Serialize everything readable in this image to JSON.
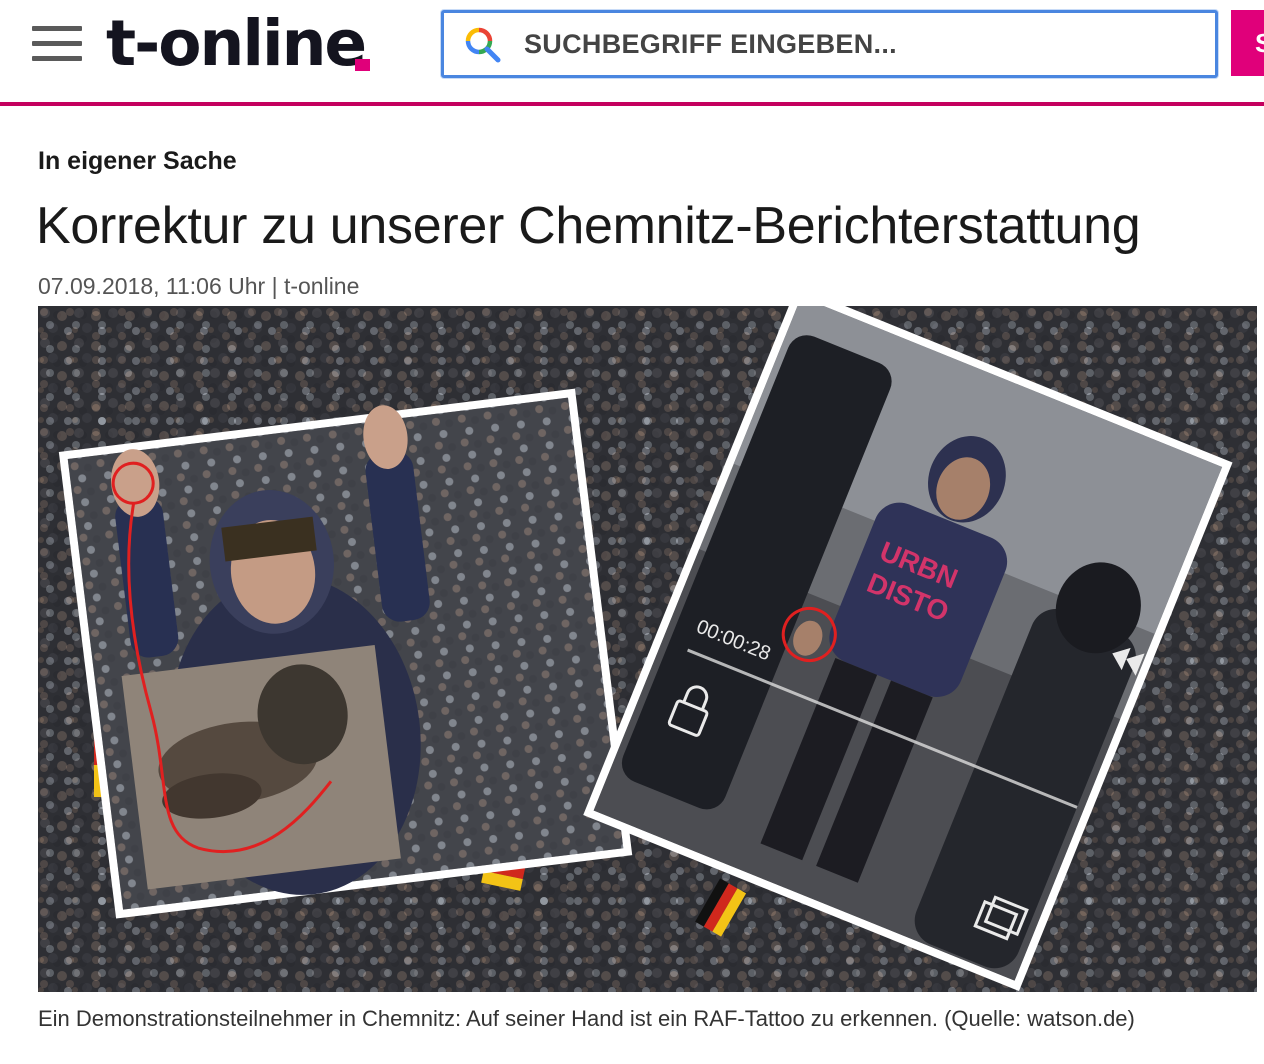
{
  "header": {
    "menu_icon": "hamburger-menu-icon",
    "logo_text": "t-online",
    "search": {
      "placeholder": "SUCHBEGRIFF EINGEBEN...",
      "icon": "search-icon"
    },
    "search_button_label": "S",
    "accent_color": "#e0007a"
  },
  "article": {
    "kicker": "In eigener Sache",
    "headline": "Korrektur zu unserer Chemnitz-Berichterstattung",
    "meta": "07.09.2018, 11:06 Uhr | t-online",
    "image": {
      "overlay_timestamp": "00:00:28",
      "shirt_text_line1": "URBN",
      "shirt_text_line2": "DISTO",
      "icons": [
        "lock-icon",
        "rewind-icon",
        "copy-icon"
      ]
    },
    "caption": "Ein Demonstrationsteilnehmer in Chemnitz: Auf seiner Hand ist ein RAF-Tattoo zu erkennen. (Quelle: watson.de)"
  }
}
